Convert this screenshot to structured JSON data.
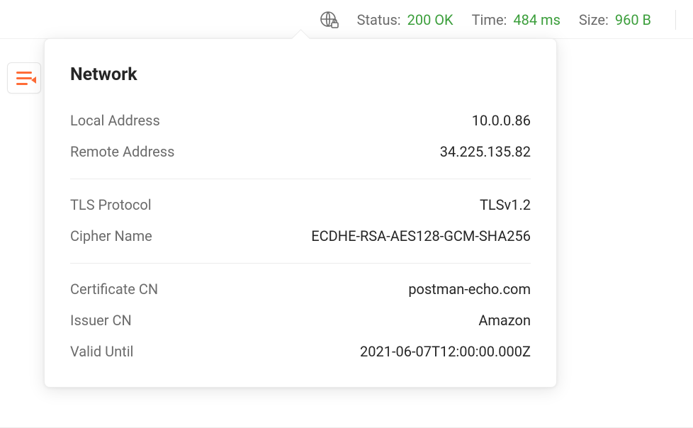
{
  "status_bar": {
    "status_label": "Status:",
    "status_value": "200 OK",
    "time_label": "Time:",
    "time_value": "484 ms",
    "size_label": "Size:",
    "size_value": "960 B"
  },
  "popover": {
    "title": "Network",
    "sections": [
      [
        {
          "label": "Local Address",
          "value": "10.0.0.86"
        },
        {
          "label": "Remote Address",
          "value": "34.225.135.82"
        }
      ],
      [
        {
          "label": "TLS Protocol",
          "value": "TLSv1.2"
        },
        {
          "label": "Cipher Name",
          "value": "ECDHE-RSA-AES128-GCM-SHA256"
        }
      ],
      [
        {
          "label": "Certificate CN",
          "value": "postman-echo.com"
        },
        {
          "label": "Issuer CN",
          "value": "Amazon"
        },
        {
          "label": "Valid Until",
          "value": "2021-06-07T12:00:00.000Z"
        }
      ]
    ]
  }
}
